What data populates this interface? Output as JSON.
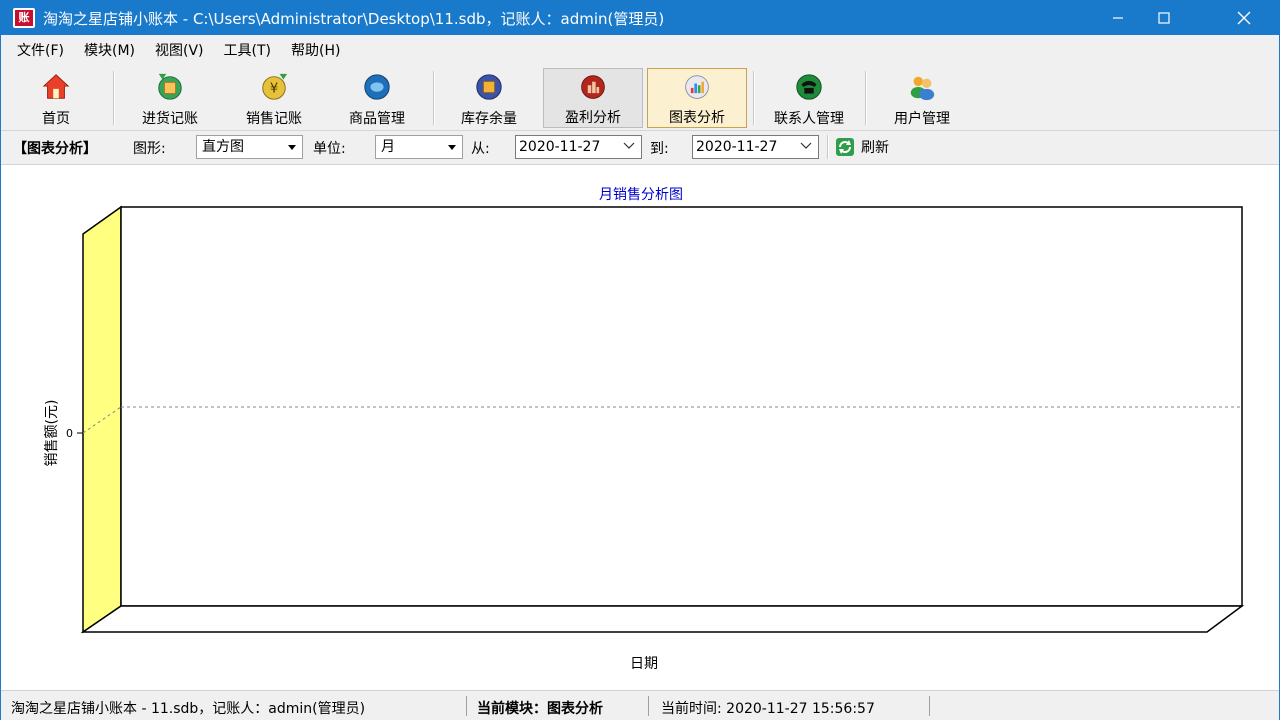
{
  "window": {
    "title": "淘淘之星店铺小账本 - C:\\Users\\Administrator\\Desktop\\11.sdb，记账人：admin(管理员)",
    "app_icon_text": "账",
    "titlebar_color": "#1979ca"
  },
  "menu": [
    "文件(F)",
    "模块(M)",
    "视图(V)",
    "工具(T)",
    "帮助(H)"
  ],
  "toolbar": {
    "home": "首页",
    "purchase": "进货记账",
    "sales": "销售记账",
    "goods": "商品管理",
    "stock": "库存余量",
    "profit": "盈利分析",
    "chart": "图表分析",
    "contacts": "联系人管理",
    "users": "用户管理"
  },
  "filter": {
    "section": "【图表分析】",
    "shape_label": "图形:",
    "shape_value": "直方图",
    "unit_label": "单位:",
    "unit_value": "月",
    "from_label": "从:",
    "from_value": "2020-11-27",
    "to_label": "到:",
    "to_value": "2020-11-27",
    "refresh": "刷新"
  },
  "chart_data": {
    "type": "bar",
    "title": "月销售分析图",
    "xlabel": "日期",
    "ylabel": "销售额(元)",
    "categories": [],
    "values": [],
    "y_ticks": [
      "0"
    ],
    "style": "3d",
    "wall_color": "#ffff80",
    "title_color": "#0000cc"
  },
  "status": {
    "app": "淘淘之星店铺小账本 - 11.sdb，记账人：admin(管理员)",
    "module": "当前模块：图表分析",
    "time": "当前时间: 2020-11-27 15:56:57"
  }
}
